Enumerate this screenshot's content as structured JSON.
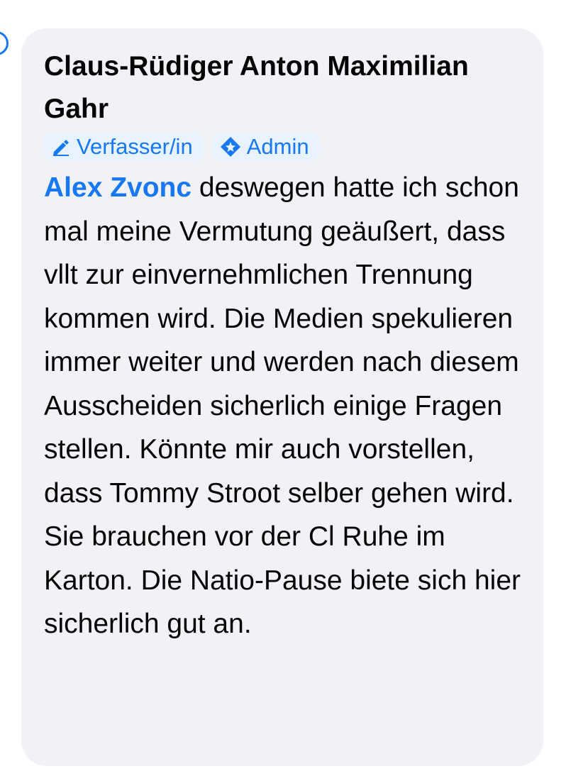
{
  "comment": {
    "author": "Claus-Rüdiger Anton Maximilian Gahr",
    "badges": [
      {
        "label": "Verfasser/in",
        "icon": "pencil-icon"
      },
      {
        "label": "Admin",
        "icon": "shield-star-icon"
      }
    ],
    "mention": "Alex Zvonc",
    "text": "deswegen hatte ich schon mal meine Vermutung geäußert, dass vllt zur einvernehmlichen Trennung kommen wird. Die Medien spekulieren immer weiter und werden nach diesem Ausscheiden sicherlich einige Fragen stellen. Könnte mir auch vorstellen, dass Tommy Stroot selber gehen wird. Sie brauchen vor der Cl Ruhe im Karton. Die Natio-Pause biete sich hier sicherlich gut an."
  },
  "colors": {
    "accent": "#1877f2",
    "bubble": "#f0f2f5",
    "badge_bg": "#e7f3ff",
    "text": "#050505"
  }
}
